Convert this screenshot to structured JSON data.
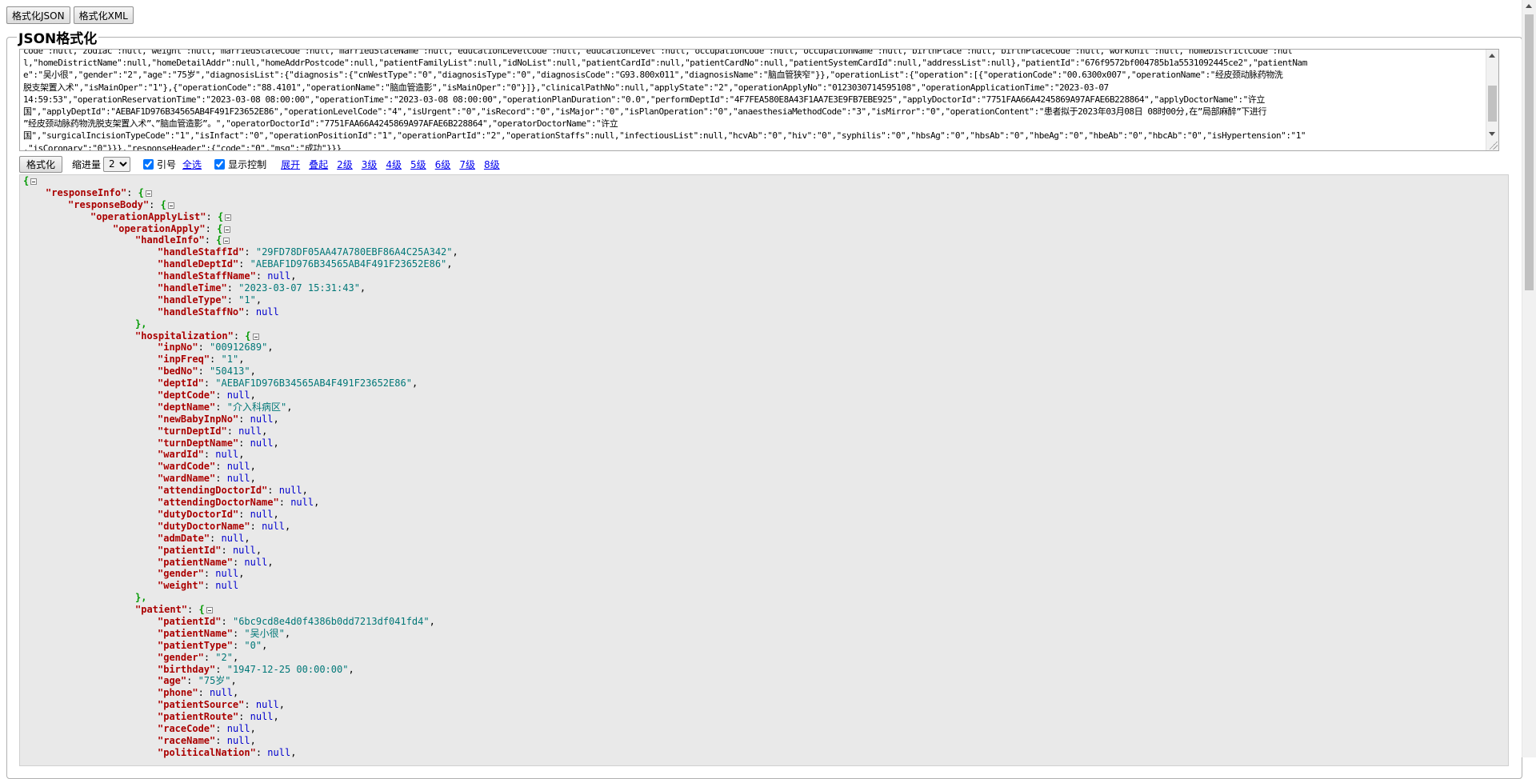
{
  "toolbar": {
    "format_json_label": "格式化JSON",
    "format_xml_label": "格式化XML"
  },
  "legend_title": "JSON格式化",
  "raw_input": {
    "lines": [
      "code\":null,\"zodiac\":null,\"weight\":null,\"marriedStateCode\":null,\"marriedStateName\":null,\"educationLevelCode\":null,\"educationLevel\":null,\"occupationCode\":null,\"occupationName\":null,\"birthPlace\":null,\"birthPlaceCode\":null,\"workUnit\":null,\"homeDistrictCode\":nul",
      "l,\"homeDistrictName\":null,\"homeDetailAddr\":null,\"homeAddrPostcode\":null,\"patientFamilyList\":null,\"idNoList\":null,\"patientCardId\":null,\"patientCardNo\":null,\"patientSystemCardId\":null,\"addressList\":null},\"patientId\":\"676f9572bf004785b1a5531092445ce2\",\"patientNam",
      "e\":\"吴小很\",\"gender\":\"2\",\"age\":\"75岁\",\"diagnosisList\":{\"diagnosis\":{\"cnWestType\":\"0\",\"diagnosisType\":\"0\",\"diagnosisCode\":\"G93.800x011\",\"diagnosisName\":\"脑血管狭窄\"}},\"operationList\":{\"operation\":[{\"operationCode\":\"00.6300x007\",\"operationName\":\"经皮颈动脉药物洗",
      "脱支架置入术\",\"isMainOper\":\"1\"},{\"operationCode\":\"88.4101\",\"operationName\":\"脑血管造影\",\"isMainOper\":\"0\"}]},\"clinicalPathNo\":null,\"applyState\":\"2\",\"operationApplyNo\":\"0123030714595108\",\"operationApplicationTime\":\"2023-03-07",
      "14:59:53\",\"operationReservationTime\":\"2023-03-08 08:00:00\",\"operationTime\":\"2023-03-08 08:00:00\",\"operationPlanDuration\":\"0.0\",\"performDeptId\":\"4F7FEA580E8A43F1AA7E3E9FB7EBE925\",\"applyDoctorId\":\"7751FAA66A4245869A97AFAE6B228864\",\"applyDoctorName\":\"许立",
      "国\",\"applyDeptId\":\"AEBAF1D976B34565AB4F491F23652E86\",\"operationLevelCode\":\"4\",\"isUrgent\":\"0\",\"isRecord\":\"0\",\"isMajor\":\"0\",\"isPlanOperation\":\"0\",\"anaesthesiaMethodCode\":\"3\",\"isMirror\":\"0\",\"operationContent\":\"患者拟于2023年03月08日 08时00分,在”局部麻醉”下进行",
      "”经皮颈动脉药物洗脱支架置入术”、”脑血管造影”。\",\"operatorDoctorId\":\"7751FAA66A4245869A97AFAE6B228864\",\"operatorDoctorName\":\"许立",
      "国\",\"surgicalIncisionTypeCode\":\"1\",\"isInfact\":\"0\",\"operationPositionId\":\"1\",\"operationPartId\":\"2\",\"operationStaffs\":null,\"infectiousList\":null,\"hcvAb\":\"0\",\"hiv\":\"0\",\"syphilis\":\"0\",\"hbsAg\":\"0\",\"hbsAb\":\"0\",\"hbeAg\":\"0\",\"hbeAb\":\"0\",\"hbcAb\":\"0\",\"isHypertension\":\"1\"",
      ",\"isCoronary\":\"0\"}}},\"responseHeader\":{\"code\":\"0\",\"msg\":\"成功\"}}}"
    ]
  },
  "controls": {
    "format_button": "格式化",
    "indent_label": "缩进量",
    "indent_value": "2",
    "quote_label": "引号",
    "select_all": "全选",
    "show_control_label": "显示控制",
    "expand": "展开",
    "collapse": "叠起",
    "levels": [
      "2级",
      "3级",
      "4级",
      "5级",
      "6级",
      "7级",
      "8级"
    ]
  },
  "tree": {
    "rows": [
      {
        "indent": 0,
        "open": "{",
        "toggle": true
      },
      {
        "indent": 1,
        "key": "responseInfo",
        "open": "{",
        "toggle": true
      },
      {
        "indent": 2,
        "key": "responseBody",
        "open": "{",
        "toggle": true
      },
      {
        "indent": 3,
        "key": "operationApplyList",
        "open": "{",
        "toggle": true
      },
      {
        "indent": 4,
        "key": "operationApply",
        "open": "{",
        "toggle": true
      },
      {
        "indent": 5,
        "key": "handleInfo",
        "open": "{",
        "toggle": true
      },
      {
        "indent": 6,
        "key": "handleStaffId",
        "str": "29FD78DF05AA47A780EBF86A4C25A342",
        "comma": true
      },
      {
        "indent": 6,
        "key": "handleDeptId",
        "str": "AEBAF1D976B34565AB4F491F23652E86",
        "comma": true
      },
      {
        "indent": 6,
        "key": "handleStaffName",
        "nul": "null",
        "comma": true
      },
      {
        "indent": 6,
        "key": "handleTime",
        "str": "2023-03-07 15:31:43",
        "comma": true
      },
      {
        "indent": 6,
        "key": "handleType",
        "str": "1",
        "comma": true
      },
      {
        "indent": 6,
        "key": "handleStaffNo",
        "nul": "null"
      },
      {
        "indent": 5,
        "close": "},"
      },
      {
        "indent": 5,
        "key": "hospitalization",
        "open": "{",
        "toggle": true
      },
      {
        "indent": 6,
        "key": "inpNo",
        "str": "00912689",
        "comma": true
      },
      {
        "indent": 6,
        "key": "inpFreq",
        "str": "1",
        "comma": true
      },
      {
        "indent": 6,
        "key": "bedNo",
        "str": "50413",
        "comma": true
      },
      {
        "indent": 6,
        "key": "deptId",
        "str": "AEBAF1D976B34565AB4F491F23652E86",
        "comma": true
      },
      {
        "indent": 6,
        "key": "deptCode",
        "nul": "null",
        "comma": true
      },
      {
        "indent": 6,
        "key": "deptName",
        "str": "介入科病区",
        "comma": true
      },
      {
        "indent": 6,
        "key": "newBabyInpNo",
        "nul": "null",
        "comma": true
      },
      {
        "indent": 6,
        "key": "turnDeptId",
        "nul": "null",
        "comma": true
      },
      {
        "indent": 6,
        "key": "turnDeptName",
        "nul": "null",
        "comma": true
      },
      {
        "indent": 6,
        "key": "wardId",
        "nul": "null",
        "comma": true
      },
      {
        "indent": 6,
        "key": "wardCode",
        "nul": "null",
        "comma": true
      },
      {
        "indent": 6,
        "key": "wardName",
        "nul": "null",
        "comma": true
      },
      {
        "indent": 6,
        "key": "attendingDoctorId",
        "nul": "null",
        "comma": true
      },
      {
        "indent": 6,
        "key": "attendingDoctorName",
        "nul": "null",
        "comma": true
      },
      {
        "indent": 6,
        "key": "dutyDoctorId",
        "nul": "null",
        "comma": true
      },
      {
        "indent": 6,
        "key": "dutyDoctorName",
        "nul": "null",
        "comma": true
      },
      {
        "indent": 6,
        "key": "admDate",
        "nul": "null",
        "comma": true
      },
      {
        "indent": 6,
        "key": "patientId",
        "nul": "null",
        "comma": true
      },
      {
        "indent": 6,
        "key": "patientName",
        "nul": "null",
        "comma": true
      },
      {
        "indent": 6,
        "key": "gender",
        "nul": "null",
        "comma": true
      },
      {
        "indent": 6,
        "key": "weight",
        "nul": "null"
      },
      {
        "indent": 5,
        "close": "},"
      },
      {
        "indent": 5,
        "key": "patient",
        "open": "{",
        "toggle": true
      },
      {
        "indent": 6,
        "key": "patientId",
        "str": "6bc9cd8e4d0f4386b0dd7213df041fd4",
        "comma": true
      },
      {
        "indent": 6,
        "key": "patientName",
        "str": "吴小很",
        "comma": true
      },
      {
        "indent": 6,
        "key": "patientType",
        "str": "0",
        "comma": true
      },
      {
        "indent": 6,
        "key": "gender",
        "str": "2",
        "comma": true
      },
      {
        "indent": 6,
        "key": "birthday",
        "str": "1947-12-25 00:00:00",
        "comma": true
      },
      {
        "indent": 6,
        "key": "age",
        "str": "75岁",
        "comma": true
      },
      {
        "indent": 6,
        "key": "phone",
        "nul": "null",
        "comma": true
      },
      {
        "indent": 6,
        "key": "patientSource",
        "nul": "null",
        "comma": true
      },
      {
        "indent": 6,
        "key": "patientRoute",
        "nul": "null",
        "comma": true
      },
      {
        "indent": 6,
        "key": "raceCode",
        "nul": "null",
        "comma": true
      },
      {
        "indent": 6,
        "key": "raceName",
        "nul": "null",
        "comma": true
      },
      {
        "indent": 6,
        "key": "politicalNation",
        "nul": "null",
        "comma": true
      }
    ]
  }
}
